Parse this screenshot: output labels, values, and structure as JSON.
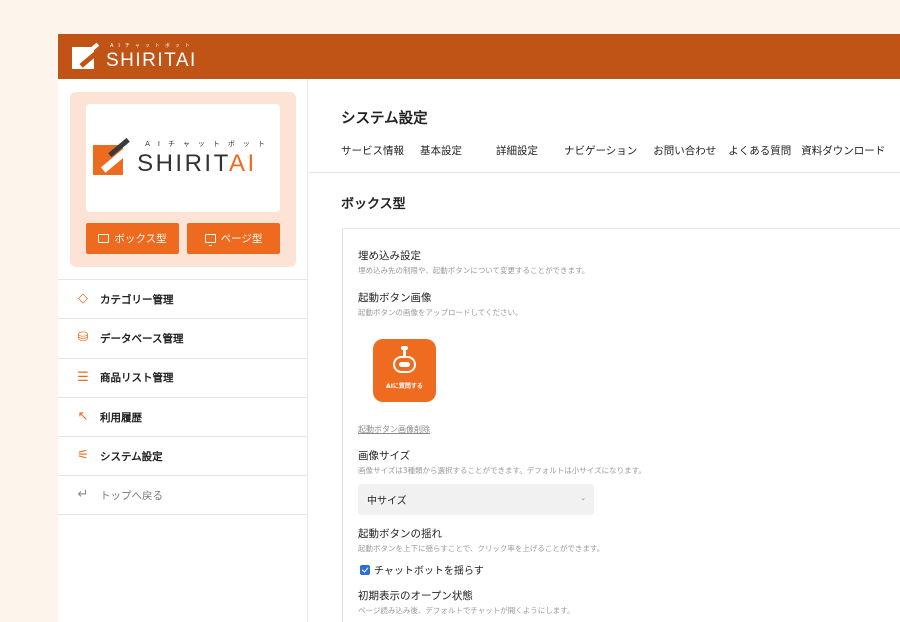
{
  "header": {
    "logo_sub": "AIチャットボット",
    "logo_main": "SHIRITAI"
  },
  "sidebar": {
    "logo_sub": "AIチャットボット",
    "logo_main_a": "SHIRIT",
    "logo_main_b": "AI",
    "box_button": "ボックス型",
    "page_button": "ページ型",
    "items": [
      {
        "label": "カテゴリー管理",
        "icon": "tag-icon"
      },
      {
        "label": "データベース管理",
        "icon": "database-icon"
      },
      {
        "label": "商品リスト管理",
        "icon": "list-icon"
      },
      {
        "label": "利用履歴",
        "icon": "cursor-icon"
      },
      {
        "label": "システム設定",
        "icon": "sliders-icon"
      },
      {
        "label": "トップへ戻る",
        "icon": "return-icon"
      }
    ]
  },
  "main": {
    "title": "システム設定",
    "tabs": [
      "サービス情報",
      "基本設定",
      "詳細設定",
      "ナビゲーション",
      "お問い合わせ",
      "よくある質問",
      "資料ダウンロード"
    ],
    "section_title": "ボックス型",
    "embed": {
      "label": "埋め込み設定",
      "desc": "埋め込み先の制限や、起動ボタンについて変更することができます。"
    },
    "button_image": {
      "label": "起動ボタン画像",
      "desc": "起動ボタンの画像をアップロードしてください。",
      "image_text": "AIに質問する",
      "delete_link": "起動ボタン画像削除"
    },
    "image_size": {
      "label": "画像サイズ",
      "desc": "画像サイズは3種類から選択することができます。デフォルトは小サイズになります。",
      "selected": "中サイズ"
    },
    "shake": {
      "label": "起動ボタンの揺れ",
      "desc": "起動ボタンを上下に揺らすことで、クリック率を上げることができます。",
      "checkbox_label": "チャットボットを揺らす",
      "checked": true
    },
    "open_state": {
      "label": "初期表示のオープン状態",
      "desc": "ページ読み込み後、デフォルトでチャットが開くようにします。"
    }
  },
  "colors": {
    "brand": "#c05417",
    "accent": "#ee6a1f",
    "card_bg": "#fde3d6",
    "page_bg": "#fdf4ec"
  }
}
